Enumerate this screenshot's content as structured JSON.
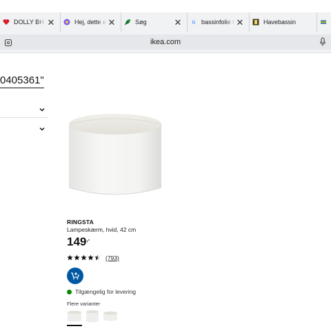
{
  "browser": {
    "tabs": [
      {
        "title": "DOLLY BH S",
        "favicon": "heart-icon",
        "color": "#d21f2b"
      },
      {
        "title": "Hej, dette er",
        "favicon": "gemini-icon",
        "color": "#8b5cf6"
      },
      {
        "title": "Søg",
        "favicon": "leaf-icon",
        "color": "#1f8a3a"
      },
      {
        "title": "bassinfolie til",
        "favicon": "google-icon",
        "color": "#4285f4"
      },
      {
        "title": "Havebassin",
        "favicon": "site-icon",
        "color": "#4a3b12"
      },
      {
        "title": "",
        "favicon": "ikea-icon",
        "color": "#0058a3"
      }
    ],
    "url": "ikea.com"
  },
  "page": {
    "query_text": "0405361\"",
    "product": {
      "name": "RINGSTA",
      "description": "Lampeskærm, hvid, 42 cm",
      "price": "149",
      "price_suffix": ",-",
      "rating": 4.5,
      "rating_count": "(793)",
      "availability": "Tilgængelig for levering",
      "variants_label": "Flere varianter",
      "variants": 3
    }
  }
}
